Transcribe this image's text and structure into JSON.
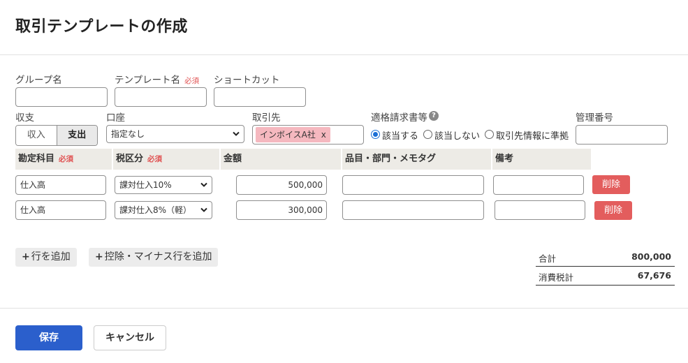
{
  "page": {
    "title": "取引テンプレートの作成"
  },
  "form": {
    "group": {
      "label": "グループ名",
      "value": ""
    },
    "template_name": {
      "label": "テンプレート名",
      "required": "必須",
      "value": ""
    },
    "shortcut": {
      "label": "ショートカット",
      "value": ""
    },
    "type": {
      "label": "収支",
      "options": [
        "収入",
        "支出"
      ],
      "selected": "支出"
    },
    "account": {
      "label": "口座",
      "value": "指定なし"
    },
    "partner": {
      "label": "取引先",
      "tag": "インボイスA社",
      "tag_remove": "x"
    },
    "invoice": {
      "label": "適格請求書等",
      "help": "?",
      "options": [
        "該当する",
        "該当しない",
        "取引先情報に準拠"
      ],
      "selected": "該当する"
    },
    "management_no": {
      "label": "管理番号",
      "value": ""
    }
  },
  "table": {
    "headers": {
      "account": "勘定科目",
      "account_req": "必須",
      "tax": "税区分",
      "tax_req": "必須",
      "amount": "金額",
      "items": "品目・部門・メモタグ",
      "note": "備考"
    },
    "rows": [
      {
        "account": "仕入高",
        "tax": "課対仕入10%",
        "amount": "500,000",
        "items": "",
        "note": "",
        "delete": "削除"
      },
      {
        "account": "仕入高",
        "tax": "課対仕入8%（軽）",
        "amount": "300,000",
        "items": "",
        "note": "",
        "delete": "削除"
      }
    ]
  },
  "actions": {
    "add_row": "行を追加",
    "add_deduction": "控除・マイナス行を追加",
    "plus": "+"
  },
  "summary": {
    "total_label": "合計",
    "total_value": "800,000",
    "tax_label": "消費税計",
    "tax_value": "67,676"
  },
  "footer": {
    "save": "保存",
    "cancel": "キャンセル"
  },
  "colors": {
    "primary": "#2b5fcc",
    "danger": "#e35d5d",
    "tag": "#f5b8bf",
    "header_bg": "#edebe6"
  }
}
